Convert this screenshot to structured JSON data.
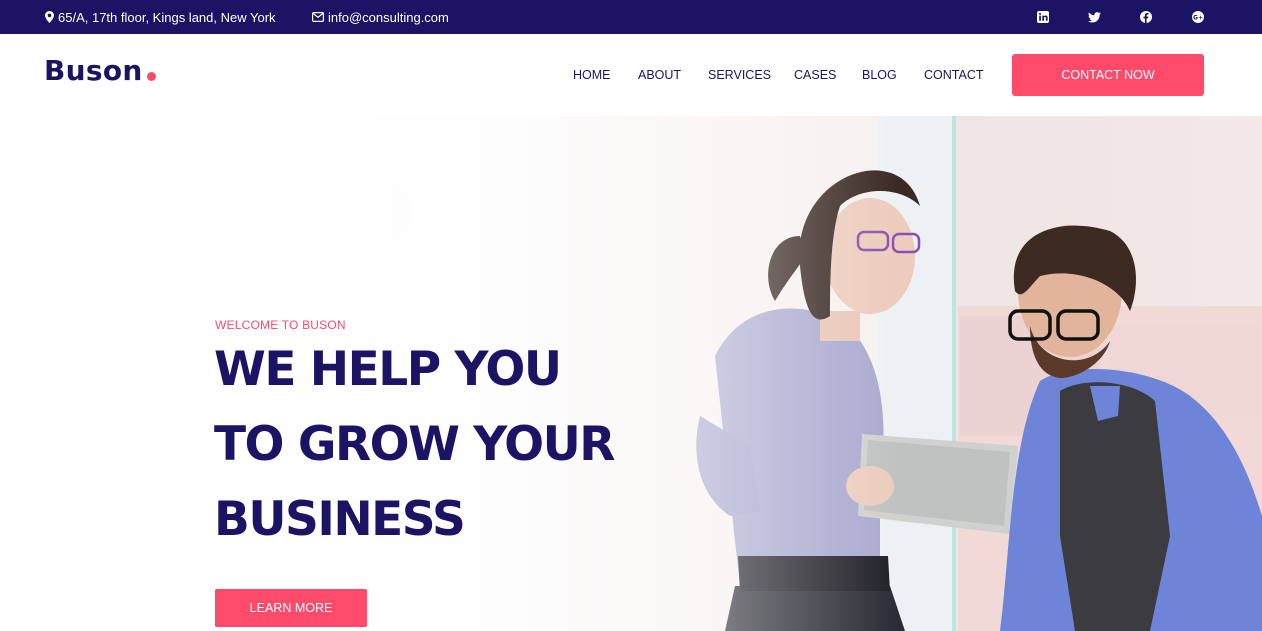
{
  "topbar": {
    "address": "65/A, 17th floor, Kings land, New York",
    "email": "info@consulting.com",
    "social": [
      "linkedin-icon",
      "twitter-icon",
      "facebook-icon",
      "google-plus-icon"
    ]
  },
  "header": {
    "logo": "Buson",
    "nav": [
      "HOME",
      "ABOUT",
      "SERVICES",
      "CASES",
      "BLOG",
      "CONTACT"
    ],
    "cta": "CONTACT NOW"
  },
  "hero": {
    "kicker": "WELCOME TO BUSON",
    "headline": [
      "WE HELP YOU",
      "TO GROW YOUR",
      "BUSINESS"
    ],
    "button": "LEARN MORE"
  },
  "colors": {
    "navy": "#1b1464",
    "accent": "#ff4a6b",
    "white": "#ffffff"
  }
}
